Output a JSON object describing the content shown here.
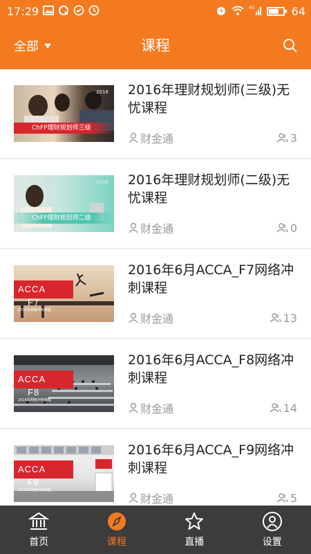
{
  "status_bar": {
    "time": "17:29",
    "battery": "64",
    "battery_level": 0.64,
    "signal_badge": "4G"
  },
  "header": {
    "filter_label": "全部",
    "title": "课程",
    "accent_color": "#f47a1f"
  },
  "courses": [
    {
      "title": "2016年理财规划师(三级)无忧课程",
      "author": "财金通",
      "count": "3",
      "thumb": {
        "caption": "ChFP理财规划师三级",
        "year": "2016"
      }
    },
    {
      "title": "2016年理财规划师(二级)无忧课程",
      "author": "财金通",
      "count": "0",
      "thumb": {
        "caption": "ChFP理财规划师二级",
        "year": "2016"
      }
    },
    {
      "title": "2016年6月ACCA_F7网络冲刺课程",
      "author": "财金通",
      "count": "13",
      "thumb": {
        "brand": "ACCA",
        "level": "F7",
        "sub": "2016年网络冲刺课程"
      }
    },
    {
      "title": "2016年6月ACCA_F8网络冲刺课程",
      "author": "财金通",
      "count": "14",
      "thumb": {
        "brand": "ACCA",
        "level": "F8",
        "sub": "2016年网络冲刺课程"
      }
    },
    {
      "title": "2016年6月ACCA_F9网络冲刺课程",
      "author": "财金通",
      "count": "5",
      "thumb": {
        "brand": "ACCA",
        "level": "F9",
        "sub": "2016年网络冲刺课程"
      }
    }
  ],
  "tabs": [
    {
      "label": "首页",
      "icon": "bank-icon",
      "active": false
    },
    {
      "label": "课程",
      "icon": "compass-icon",
      "active": true
    },
    {
      "label": "直播",
      "icon": "star-icon",
      "active": false
    },
    {
      "label": "设置",
      "icon": "user-circle-icon",
      "active": false
    }
  ]
}
